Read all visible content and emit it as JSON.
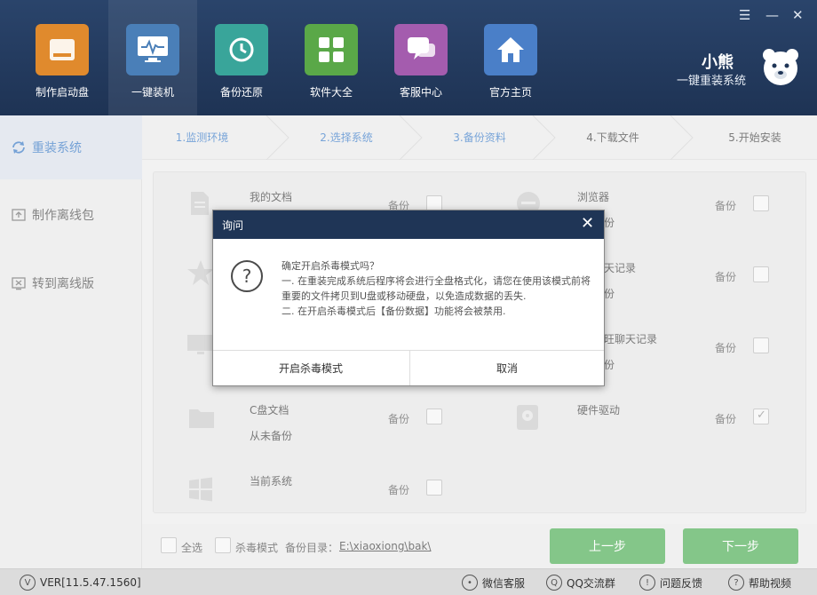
{
  "window": {
    "min_glyph": "☰",
    "minimize_glyph": "—",
    "close_glyph": "✕"
  },
  "nav": [
    {
      "label": "制作启动盘",
      "icon": "usb-disk-icon",
      "color": "#e08a2d"
    },
    {
      "label": "一键装机",
      "icon": "monitor-icon",
      "color": "#4a7fb8"
    },
    {
      "label": "备份还原",
      "icon": "restore-icon",
      "color": "#39a59a"
    },
    {
      "label": "软件大全",
      "icon": "apps-grid-icon",
      "color": "#5aa848"
    },
    {
      "label": "客服中心",
      "icon": "chat-icon",
      "color": "#a45cae"
    },
    {
      "label": "官方主页",
      "icon": "home-icon",
      "color": "#4a7fc8"
    }
  ],
  "brand": {
    "title": "小熊",
    "subtitle": "一键重装系统",
    "icon": "bear-logo-icon"
  },
  "sidebar": {
    "items": [
      {
        "label": "重装系统",
        "icon": "refresh-icon"
      },
      {
        "label": "制作离线包",
        "icon": "package-icon"
      },
      {
        "label": "转到离线版",
        "icon": "offline-icon"
      }
    ]
  },
  "steps": [
    {
      "label": "1.监测环境"
    },
    {
      "label": "2.选择系统"
    },
    {
      "label": "3.备份资料"
    },
    {
      "label": "4.下载文件"
    },
    {
      "label": "5.开始安装"
    }
  ],
  "backup_items": {
    "left": [
      {
        "title": "我的文档",
        "sub": "",
        "backup": "备份",
        "checked": false,
        "icon": "document-icon"
      },
      {
        "title": "",
        "sub": "",
        "backup": "",
        "checked": false,
        "icon": "star-icon"
      },
      {
        "title": "",
        "sub": "",
        "backup": "",
        "checked": false,
        "icon": "desktop-icon"
      },
      {
        "title": "C盘文档",
        "sub": "从未备份",
        "backup": "备份",
        "checked": false,
        "icon": "folder-icon"
      },
      {
        "title": "当前系统",
        "sub": "",
        "backup": "备份",
        "checked": false,
        "icon": "windows-icon"
      }
    ],
    "right": [
      {
        "title": "浏览器",
        "sub": "份",
        "backup": "备份",
        "checked": false,
        "icon": "browser-icon"
      },
      {
        "title": "天记录",
        "sub": "份",
        "backup": "备份",
        "checked": false,
        "icon": "qq-icon"
      },
      {
        "title": "旺聊天记录",
        "sub": "份",
        "backup": "备份",
        "checked": false,
        "icon": "wangwang-icon"
      },
      {
        "title": "硬件驱动",
        "sub": "",
        "backup": "备份",
        "checked": true,
        "icon": "hardware-icon"
      }
    ]
  },
  "toolbar": {
    "select_all": "全选",
    "antivirus_mode": "杀毒模式",
    "backup_dir_label": "备份目录：",
    "backup_dir": "E:\\xiaoxiong\\bak\\",
    "prev": "上一步",
    "next": "下一步"
  },
  "status": {
    "version": "VER[11.5.47.1560]",
    "wechat": "微信客服",
    "qq_group": "QQ交流群",
    "feedback": "问题反馈",
    "help": "帮助视频"
  },
  "dialog": {
    "title": "询问",
    "question_icon": "?",
    "line1": "确定开启杀毒模式吗？",
    "line2": "一. 在重装完成系统后程序将会进行全盘格式化，请您在使用该模式前将重要的文件拷贝到U盘或移动硬盘，以免造成数据的丢失.",
    "line3": "二. 在开启杀毒模式后【备份数据】功能将会被禁用.",
    "confirm": "开启杀毒模式",
    "cancel": "取消"
  }
}
